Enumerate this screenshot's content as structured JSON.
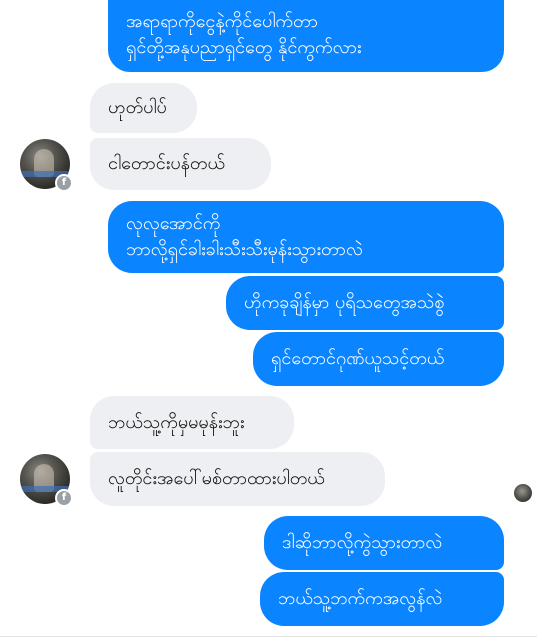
{
  "conversation": {
    "messages": [
      {
        "direction": "out",
        "text": "အရာရာကိုငွေနဲ့ကိုင်ပေါက်တာ\nရှင်တို့အနုပညာရှင်တွေ နိုင်ကွက်လား"
      },
      {
        "direction": "in",
        "text": "ဟုတ်ပါပ်"
      },
      {
        "direction": "in",
        "text": "ငါတောင်းပန်တယ်"
      },
      {
        "direction": "out",
        "text": "လုလုအောင်ကို\nဘာလို့ရှင်ခါးခါးသီးသီးမုန်းသွားတာလဲ"
      },
      {
        "direction": "out",
        "text": "ဟိုကခုချိန်မှာ ပုရိသတွေအသဲစွဲ"
      },
      {
        "direction": "out",
        "text": "ရှင်တောင်ဂုဏ်ယူသင့်တယ်"
      },
      {
        "direction": "in",
        "text": "ဘယ်သူ့ကိုမှမမုန်းဘူး"
      },
      {
        "direction": "in",
        "text": "လူတိုင်းအပေါ်မစ်တာထားပါတယ်"
      },
      {
        "direction": "out",
        "text": "ဒါဆိုဘာလို့ကွဲသွားတာလဲ"
      },
      {
        "direction": "out",
        "text": "ဘယ်သူ့ဘက်ကအလွန်လဲ"
      }
    ]
  },
  "contact": {
    "avatar_icon": "profile-photo",
    "badge_icon": "facebook-icon",
    "badge_glyph": "f"
  },
  "colors": {
    "outgoing_bubble": "#0a84ff",
    "incoming_bubble": "#eeeff2",
    "background": "#ffffff"
  }
}
